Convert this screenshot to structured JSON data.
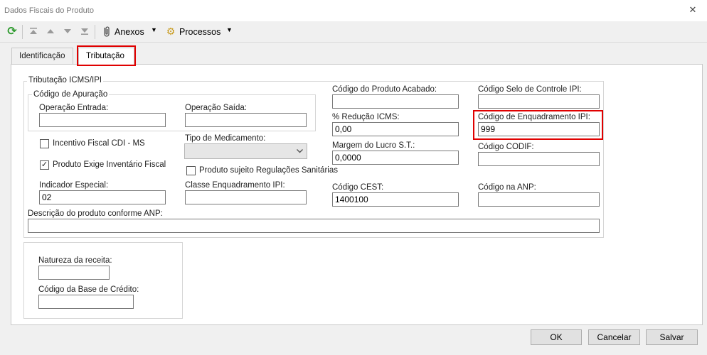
{
  "window": {
    "title": "Dados Fiscais do Produto",
    "close_icon": "close-icon"
  },
  "toolbar": {
    "refresh_icon": "refresh-icon",
    "nav_icons": [
      "first-record-icon",
      "previous-record-icon",
      "next-record-icon",
      "last-record-icon"
    ],
    "anexos_label": "Anexos",
    "processos_label": "Processos"
  },
  "tabs": [
    {
      "label": "Identificação",
      "active": false
    },
    {
      "label": "Tributação",
      "active": true
    }
  ],
  "icms_ipi": {
    "legend": "Tributação ICMS/IPI",
    "apuracao": {
      "legend": "Código de Apuração",
      "operacao_entrada": {
        "label": "Operação Entrada:",
        "value": ""
      },
      "operacao_saida": {
        "label": "Operação Saída:",
        "value": ""
      }
    },
    "incentivo_fiscal": {
      "label": "Incentivo Fiscal  CDI - MS",
      "checked": false
    },
    "produto_exige_inventario": {
      "label": "Produto Exige Inventário Fiscal",
      "checked": true
    },
    "tipo_medicamento": {
      "label": "Tipo de Medicamento:",
      "value": ""
    },
    "regulacoes_sanitarias": {
      "label": "Produto sujeito Regulações Sanitárias",
      "checked": false
    },
    "indicador_especial": {
      "label": "Indicador Especial:",
      "value": "02"
    },
    "classe_enquadramento_ipi": {
      "label": "Classe Enquadramento IPI:",
      "value": ""
    },
    "codigo_produto_acabado": {
      "label": "Código do Produto Acabado:",
      "value": ""
    },
    "reducao_icms": {
      "label": "% Redução ICMS:",
      "value": "0,00"
    },
    "margem_lucro_st": {
      "label": "Margem do Lucro S.T.:",
      "value": "0,0000"
    },
    "codigo_cest": {
      "label": "Código CEST:",
      "value": "1400100"
    },
    "codigo_selo_controle_ipi": {
      "label": "Código Selo de Controle IPI:",
      "value": ""
    },
    "codigo_enquadramento_ipi": {
      "label": "Código de Enquadramento IPI:",
      "value": "999"
    },
    "codigo_codif": {
      "label": "Código CODIF:",
      "value": ""
    },
    "codigo_anp": {
      "label": "Código na ANP:",
      "value": ""
    },
    "descricao_anp": {
      "label": "Descrição do produto conforme ANP:",
      "value": ""
    }
  },
  "receita": {
    "natureza_receita": {
      "label": "Natureza da receita:",
      "value": ""
    },
    "codigo_base_credito": {
      "label": "Código da Base de Crédito:",
      "value": ""
    }
  },
  "buttons": {
    "ok": "OK",
    "cancelar": "Cancelar",
    "salvar": "Salvar"
  },
  "colors": {
    "highlight": "#e00000",
    "refresh_green": "#2e9a2e",
    "panel_bg": "#ffffff",
    "window_bg": "#f0f0f0"
  }
}
